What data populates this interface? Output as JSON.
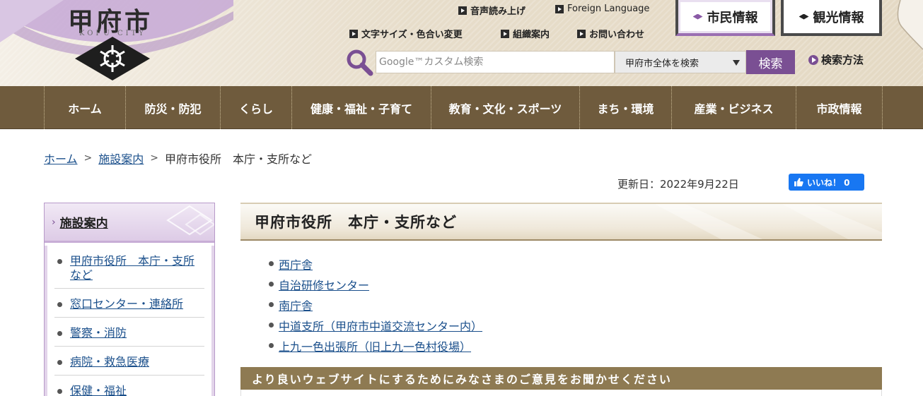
{
  "header": {
    "logo_text": "甲府市",
    "logo_sub": "KOFU CITY",
    "links": {
      "voice": "音声読み上げ",
      "foreign": "Foreign Language",
      "text_size": "文字サイズ・色合い変更",
      "org": "組織案内",
      "contact": "お問い合わせ"
    },
    "tabs": {
      "citizen": "市民情報",
      "tourism": "観光情報"
    },
    "search": {
      "placeholder": "Google™カスタム検索",
      "scope": "甲府市全体を検索",
      "button": "検索",
      "help": "検索方法"
    }
  },
  "nav": {
    "items": [
      "ホーム",
      "防災・防犯",
      "くらし",
      "健康・福祉・子育て",
      "教育・文化・スポーツ",
      "まち・環境",
      "産業・ビジネス",
      "市政情報"
    ]
  },
  "breadcrumb": {
    "home": "ホーム",
    "facility": "施設案内",
    "sep1": ">",
    "sep2": ">",
    "current": "甲府市役所　本庁・支所など"
  },
  "updated": "更新日：2022年9月22日",
  "fb_like": "いいね！ 0",
  "sidebar": {
    "title": "施設案内",
    "items": [
      "甲府市役所　本庁・支所など",
      "窓口センター・連絡所",
      "警察・消防",
      "病院・救急医療",
      "保健・福祉"
    ]
  },
  "main": {
    "title": "甲府市役所　本庁・支所など",
    "links": [
      "西庁舎",
      "自治研修センター",
      "南庁舎",
      "中道支所（甲府市中道交流センター内）",
      "上九一色出張所（旧上九一色村役場）"
    ],
    "feedback": "より良いウェブサイトにするためにみなさまのご意見をお聞かせください"
  },
  "colors": {
    "nav_bg": "#6f5b3d",
    "accent_purple": "#7a4f93",
    "link": "#1a4f8b",
    "feedback_bg": "#8e7a52",
    "fb_blue": "#1877f2"
  }
}
